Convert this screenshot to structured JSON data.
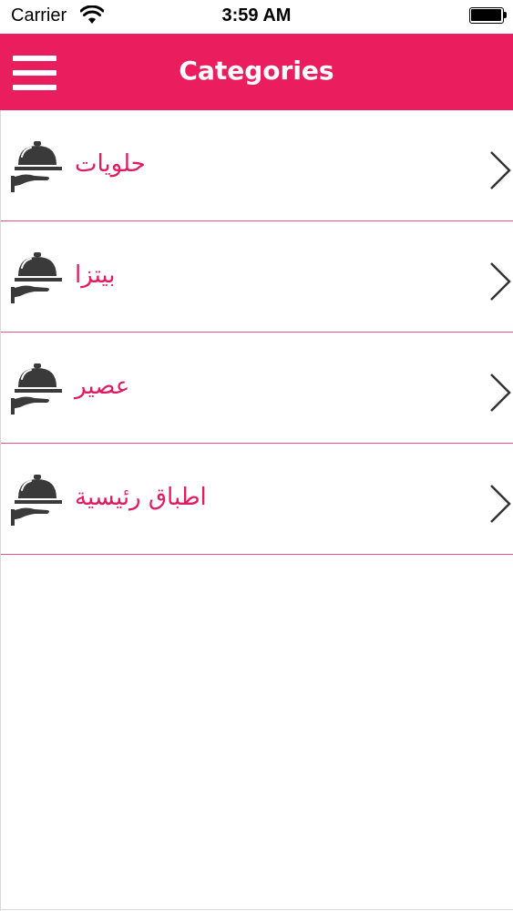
{
  "status_bar": {
    "carrier": "Carrier",
    "time": "3:59 AM",
    "wifi_icon": "wifi-icon",
    "battery_icon": "battery-icon"
  },
  "nav": {
    "title": "Categories",
    "menu_icon": "hamburger-menu-icon",
    "accent_color": "#ea1e5e"
  },
  "categories": [
    {
      "label": "حلويات",
      "icon": "serving-cloche-icon",
      "chevron": "chevron-right-icon"
    },
    {
      "label": "بيتزا",
      "icon": "serving-cloche-icon",
      "chevron": "chevron-right-icon"
    },
    {
      "label": "عصير",
      "icon": "serving-cloche-icon",
      "chevron": "chevron-right-icon"
    },
    {
      "label": "اطباق رئيسية",
      "icon": "serving-cloche-icon",
      "chevron": "chevron-right-icon"
    }
  ],
  "colors": {
    "label_text": "#e01c5f",
    "separator": "#e8527c",
    "icon": "#3a3a3a"
  }
}
